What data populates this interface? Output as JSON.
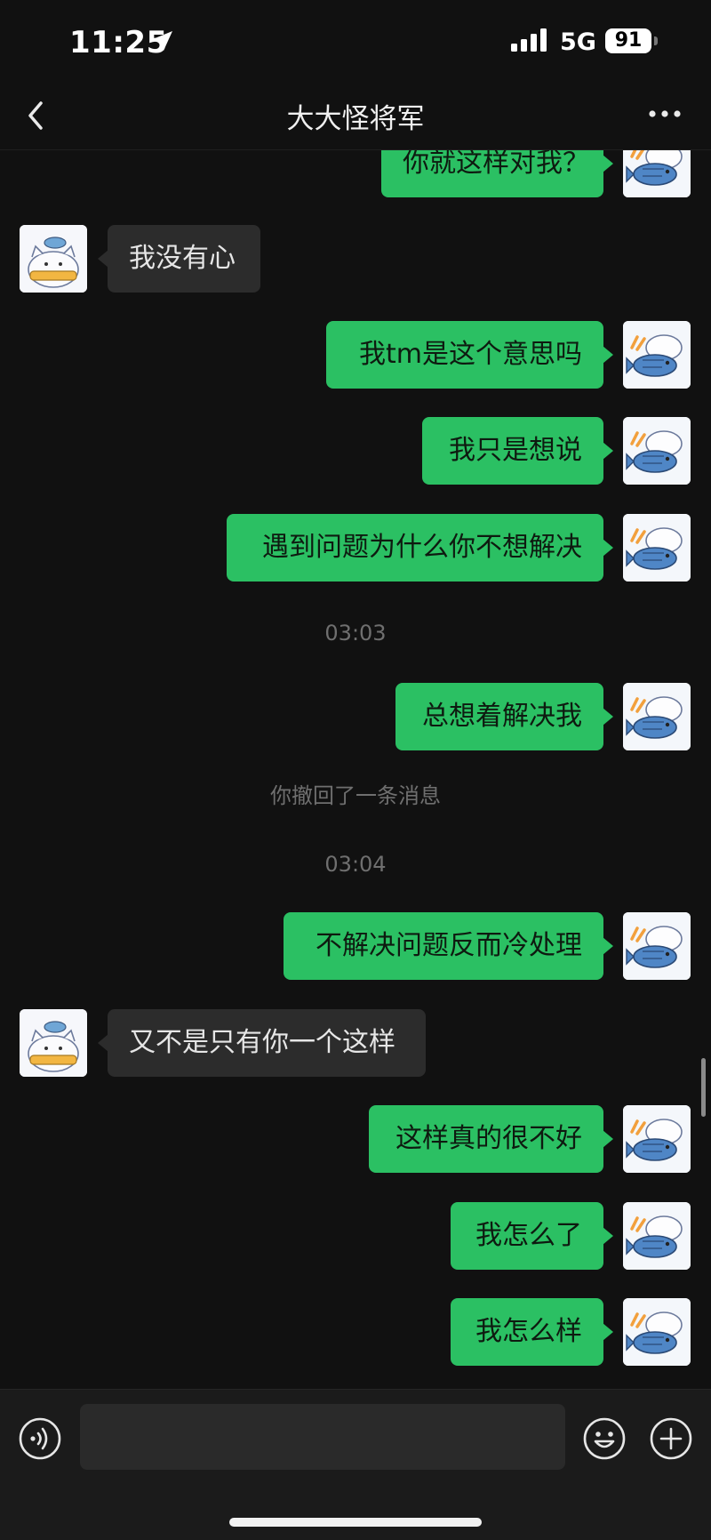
{
  "status_bar": {
    "time": "11:25",
    "network": "5G",
    "battery": "91"
  },
  "nav": {
    "title": "大大怪将军"
  },
  "messages": [
    {
      "side": "out",
      "text": "你就这样对我？"
    },
    {
      "side": "in",
      "text": "我没有心"
    },
    {
      "side": "out",
      "text": "我tm是这个意思吗"
    },
    {
      "side": "out",
      "text": "我只是想说"
    },
    {
      "side": "out",
      "text": "遇到问题为什么你不想解决"
    },
    {
      "side": "time",
      "text": "03:03"
    },
    {
      "side": "out",
      "text": "总想着解决我"
    },
    {
      "side": "system",
      "text": "你撤回了一条消息"
    },
    {
      "side": "time",
      "text": "03:04"
    },
    {
      "side": "out",
      "text": "不解决问题反而冷处理"
    },
    {
      "side": "in",
      "text": "又不是只有你一个这样"
    },
    {
      "side": "out",
      "text": "这样真的很不好"
    },
    {
      "side": "out",
      "text": "我怎么了"
    },
    {
      "side": "out",
      "text": "我怎么样"
    }
  ],
  "input": {
    "value": "",
    "placeholder": ""
  },
  "icons": {
    "back": "chevron-left-icon",
    "more": "more-dots-icon",
    "voice": "voice-icon",
    "emoji": "emoji-icon",
    "plus": "plus-icon"
  },
  "colors": {
    "background": "#111111",
    "outgoing_bubble": "#2bc063",
    "incoming_bubble": "#2c2c2c"
  }
}
